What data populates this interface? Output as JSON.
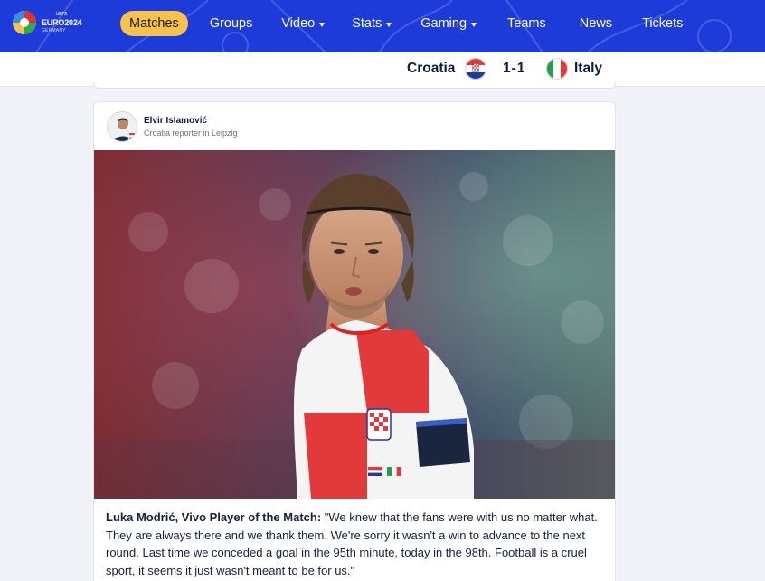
{
  "nav": {
    "logo": {
      "top_label": "UEFA",
      "title": "EURO2024",
      "sub": "GERMANY"
    },
    "items": [
      {
        "label": "Matches",
        "caret": false,
        "active": true
      },
      {
        "label": "Groups",
        "caret": false,
        "active": false
      },
      {
        "label": "Video",
        "caret": true,
        "active": false
      },
      {
        "label": "Stats",
        "caret": true,
        "active": false
      },
      {
        "label": "Gaming",
        "caret": true,
        "active": false
      },
      {
        "label": "Teams",
        "caret": false,
        "active": false
      },
      {
        "label": "News",
        "caret": false,
        "active": false
      },
      {
        "label": "Tickets",
        "caret": false,
        "active": false
      }
    ],
    "colors": {
      "background": "#1c3bd8",
      "active_pill": "#f6c24a"
    }
  },
  "match": {
    "home": "Croatia",
    "away": "Italy",
    "score": "1-1",
    "home_flag": "croatia-flag-icon",
    "away_flag": "italy-flag-icon"
  },
  "post": {
    "author_name": "Elvir Islamović",
    "author_role": "Croatia reporter in Leipzig",
    "image": "player-photo",
    "quote_lead": "Luka Modrić, Vivo Player of the Match:",
    "quote_text": " \"We knew that the fans were with us no matter what. They are always there and we thank them. We're sorry it wasn't a win to advance to the next round. Last time we conceded a goal in the 95th minute, today in the 98th. Football is a cruel sport, it seems it just wasn't meant to be for us.\""
  }
}
